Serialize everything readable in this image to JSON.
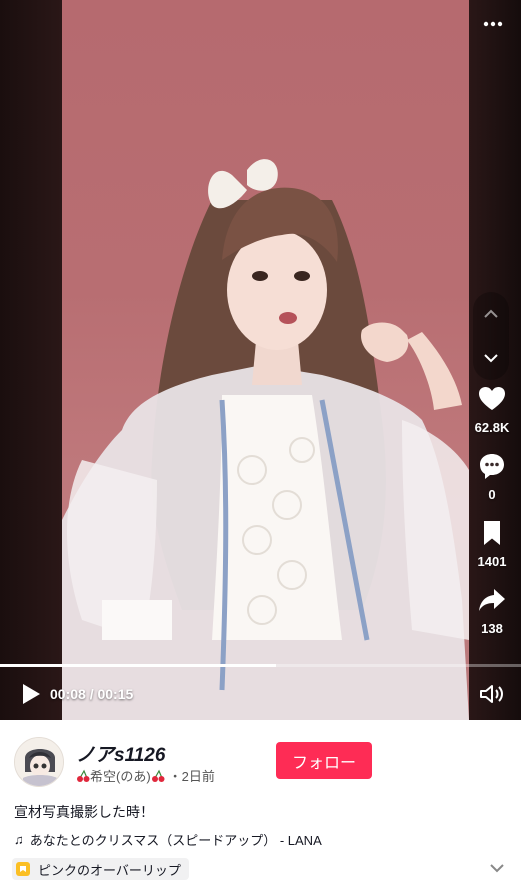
{
  "video": {
    "time_display": "00:08 / 00:15",
    "progress_fraction": 0.53
  },
  "actions": {
    "likes": "62.8K",
    "comments": "0",
    "saves": "1401",
    "shares": "138"
  },
  "author": {
    "username": "ノアs1126",
    "display_name": "希空(のあ)",
    "posted": "・2日前"
  },
  "follow_label": "フォロー",
  "caption": "宣材写真撮影した時！",
  "music": "あなたとのクリスマス（スピードアップ） - LANA",
  "tag": "ピンクのオーバーリップ",
  "colors": {
    "follow": "#fe2c55",
    "background_wall": "#b86e72"
  },
  "icons": [
    "more-icon",
    "chevron-up-icon",
    "chevron-down-icon",
    "heart-icon",
    "comment-icon",
    "bookmark-icon",
    "share-icon",
    "play-icon",
    "volume-icon",
    "music-note-icon",
    "cherry-icon",
    "tag-icon",
    "expand-icon"
  ]
}
